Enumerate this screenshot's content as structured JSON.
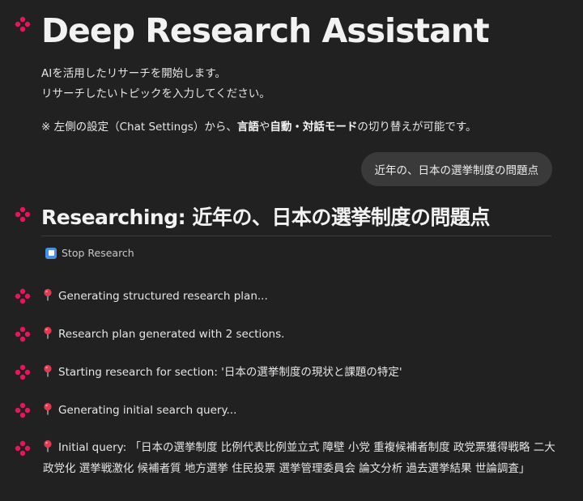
{
  "app": {
    "title": "Deep Research Assistant",
    "intro_line1": "AIを活用したリサーチを開始します。",
    "intro_line2": "リサーチしたいトピックを入力してください。",
    "note": {
      "prefix": "※ 左側の設定（Chat Settings）から、",
      "b1": "言語",
      "mid1": "や",
      "b2": "自動・対話モード",
      "suffix": "の切り替えが可能です。"
    }
  },
  "user_message": "近年の、日本の選挙制度の問題点",
  "research": {
    "heading": "Researching: 近年の、日本の選挙制度の問題点",
    "stop_label": "Stop Research"
  },
  "steps": [
    "Generating structured research plan...",
    "Research plan generated with 2 sections.",
    "Starting research for section: '日本の選挙制度の現状と課題の特定'",
    "Generating initial search query...",
    "Initial query: 「日本の選挙制度 比例代表比例並立式 障壁 小党 重複候補者制度 政党票獲得戦略 二大政党化 選挙戦激化 候補者質 地方選挙 住民投票 選挙管理委員会 論文分析 過去選挙結果 世論調査」"
  ],
  "colors": {
    "background": "#212121",
    "avatar_accent": "#e8155a",
    "bubble": "#3a3a3a",
    "stop_icon": "#4a8fe7",
    "pin": "#e03a52"
  },
  "icons": {
    "avatar": "sparkle-logo-icon",
    "step_marker": "round-pushpin-icon",
    "stop": "stop-square-icon"
  }
}
